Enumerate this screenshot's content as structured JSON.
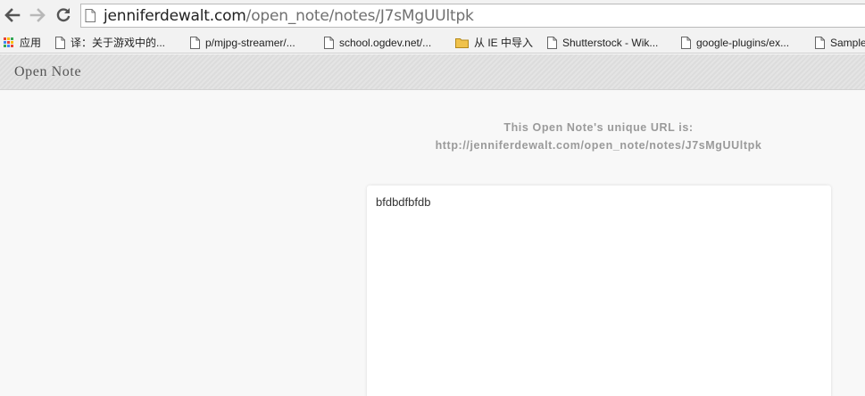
{
  "browser": {
    "url_host": "jenniferdewalt.com",
    "url_path": "/open_note/notes/J7sMgUUltpk",
    "buttons": {
      "back": "arrow-left-icon",
      "forward": "arrow-right-icon",
      "reload": "reload-icon"
    }
  },
  "bookmarks": {
    "apps_label": "应用",
    "items": [
      {
        "label": "译：关于游戏中的...",
        "icon": "page-icon"
      },
      {
        "label": "p/mjpg-streamer/...",
        "icon": "page-icon"
      },
      {
        "label": "school.ogdev.net/...",
        "icon": "page-icon"
      },
      {
        "label": "从 IE 中导入",
        "icon": "folder-icon"
      },
      {
        "label": "Shutterstock - Wik...",
        "icon": "page-icon"
      },
      {
        "label": "google-plugins/ex...",
        "icon": "page-icon"
      },
      {
        "label": "Sample",
        "icon": "page-icon"
      }
    ]
  },
  "site": {
    "brand": "Open Note"
  },
  "note": {
    "url_caption": "This Open Note's unique URL is:",
    "url": "http://jenniferdewalt.com/open_note/notes/J7sMgUUltpk",
    "content": "bfdbdfbfdb"
  },
  "colors": {
    "page_bg": "#f8f8f8",
    "header_bg": "#e0e0e0",
    "caption_text": "#9a9a9a",
    "card_bg": "#ffffff",
    "folder": "#f0c24b"
  }
}
